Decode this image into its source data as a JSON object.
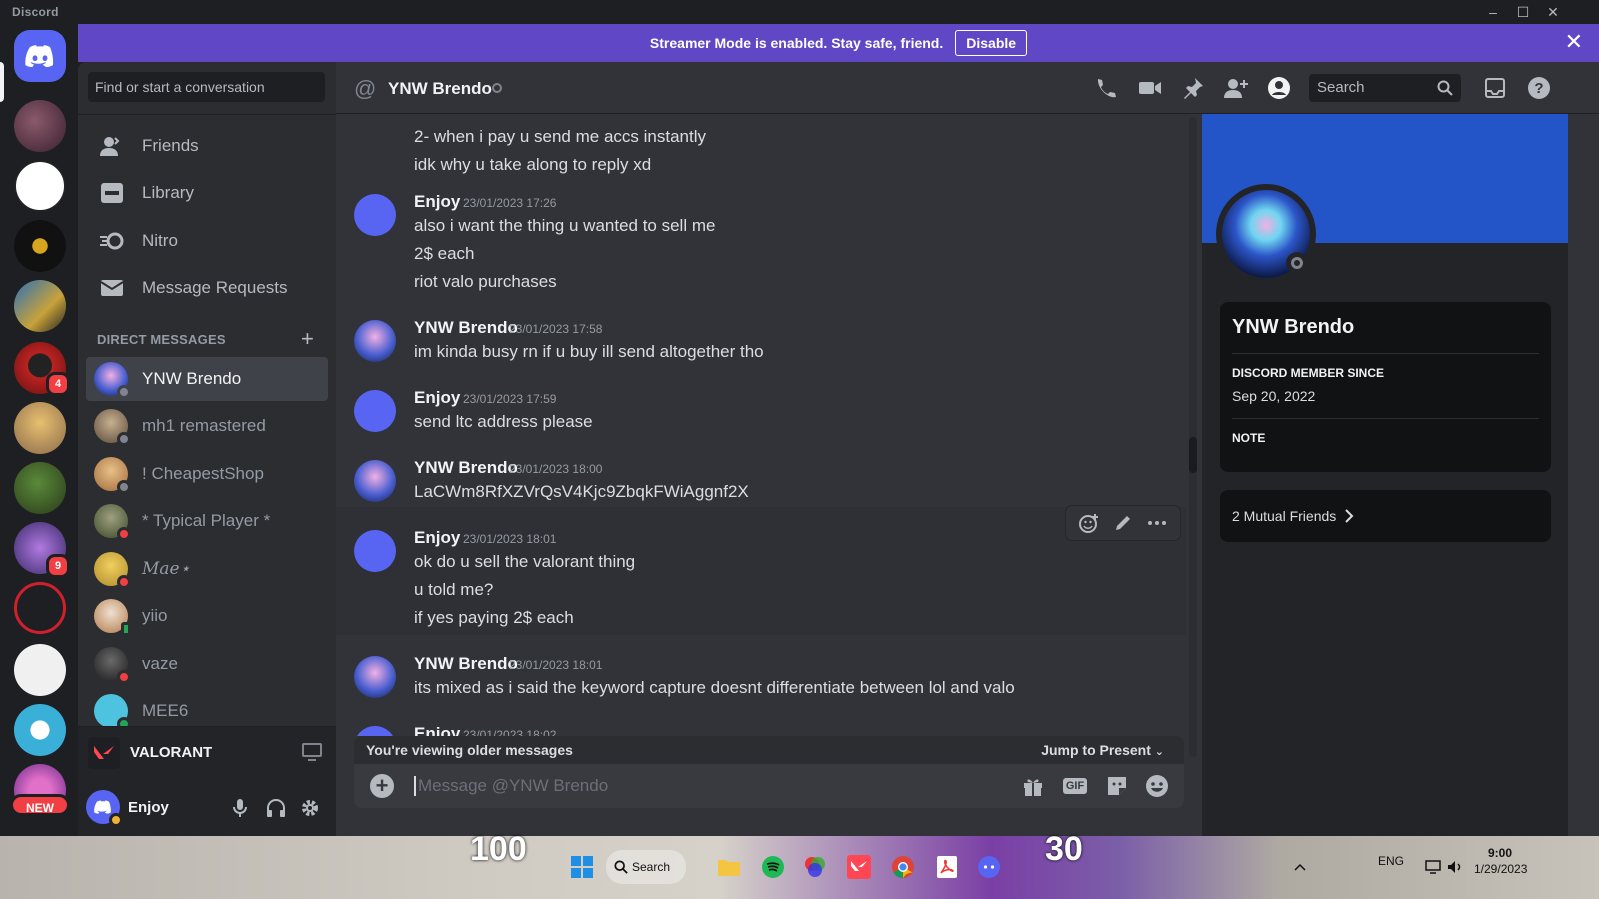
{
  "window": {
    "brand": "Discord",
    "controls": [
      "–",
      "☐",
      "✕"
    ]
  },
  "banner": {
    "text": "Streamer Mode is enabled. Stay safe, friend.",
    "button": "Disable",
    "close": "✕"
  },
  "rail": {
    "badges": [
      "4",
      "9"
    ],
    "new_badge": "NEW"
  },
  "sidebar": {
    "search_placeholder": "Find or start a conversation",
    "nav": [
      {
        "label": "Friends",
        "icon": "friends-icon"
      },
      {
        "label": "Library",
        "icon": "library-icon"
      },
      {
        "label": "Nitro",
        "icon": "nitro-icon"
      },
      {
        "label": "Message Requests",
        "icon": "message-requests-icon"
      }
    ],
    "dm_header": "DIRECT MESSAGES",
    "dm_plus": "+",
    "dms": [
      {
        "name": "YNW Brendo",
        "status": "offline",
        "color": "#4a5fd0"
      },
      {
        "name": "mh1 remastered",
        "status": "offline",
        "color": "#7a6a4e"
      },
      {
        "name": "! CheapestShop",
        "status": "offline",
        "color": "#c8a06a"
      },
      {
        "name": "* Typical Player *",
        "status": "dnd",
        "color": "#5b6a3e"
      },
      {
        "name": "Mae⋆",
        "status": "dnd",
        "color": "#d8b93a"
      },
      {
        "name": "yiio",
        "status": "mobile",
        "color": "#b07a4a"
      },
      {
        "name": "vaze",
        "status": "dnd",
        "color": "#3a3a3a"
      },
      {
        "name": "MEE6",
        "status": "online",
        "color": "#4ec3e0"
      }
    ],
    "activity": "VALORANT",
    "user": "Enjoy"
  },
  "chat": {
    "header_name": "YNW Brendo",
    "search_placeholder": "Search",
    "messages": [
      {
        "lines": [
          "2- when i pay u send me accs instantly",
          "idk why u take along to reply xd"
        ]
      },
      {
        "author": "Enjoy",
        "time": "23/01/2023 17:26",
        "lines": [
          "also i want the thing u wanted to sell me",
          "2$ each",
          "riot valo purchases"
        ]
      },
      {
        "author": "YNW Brendo",
        "time": "23/01/2023 17:58",
        "lines": [
          "im kinda busy rn if u buy ill send altogether tho"
        ]
      },
      {
        "author": "Enjoy",
        "time": "23/01/2023 17:59",
        "lines": [
          "send ltc address please"
        ]
      },
      {
        "author": "YNW Brendo",
        "time": "23/01/2023 18:00",
        "lines": [
          "LaCWm8RfXZVrQsV4Kjc9ZbqkFWiAggnf2X"
        ]
      },
      {
        "author": "Enjoy",
        "time": "23/01/2023 18:01",
        "lines": [
          "ok do u sell the valorant thing",
          "u told me?",
          "if yes paying 2$ each"
        ]
      },
      {
        "author": "YNW Brendo",
        "time": "23/01/2023 18:01",
        "lines": [
          "its mixed as i said the keyword capture doesnt differentiate between lol and valo"
        ]
      },
      {
        "author": "Enjoy",
        "time": "23/01/2023 18:02",
        "lines": []
      }
    ],
    "older_notice": "You're viewing older messages",
    "jump": "Jump to Present",
    "composer_placeholder": "Message @YNW Brendo",
    "gif_label": "GIF"
  },
  "profile": {
    "name": "YNW Brendo",
    "member_since_label": "DISCORD MEMBER SINCE",
    "member_since": "Sep 20, 2022",
    "note_label": "NOTE",
    "mutual": "2 Mutual Friends",
    "banner_color": "#2455c8"
  },
  "taskbar": {
    "search": "Search",
    "lang": "ENG",
    "time": "9:00",
    "date": "1/29/2023",
    "hud_left": "100",
    "hud_right": "30"
  }
}
